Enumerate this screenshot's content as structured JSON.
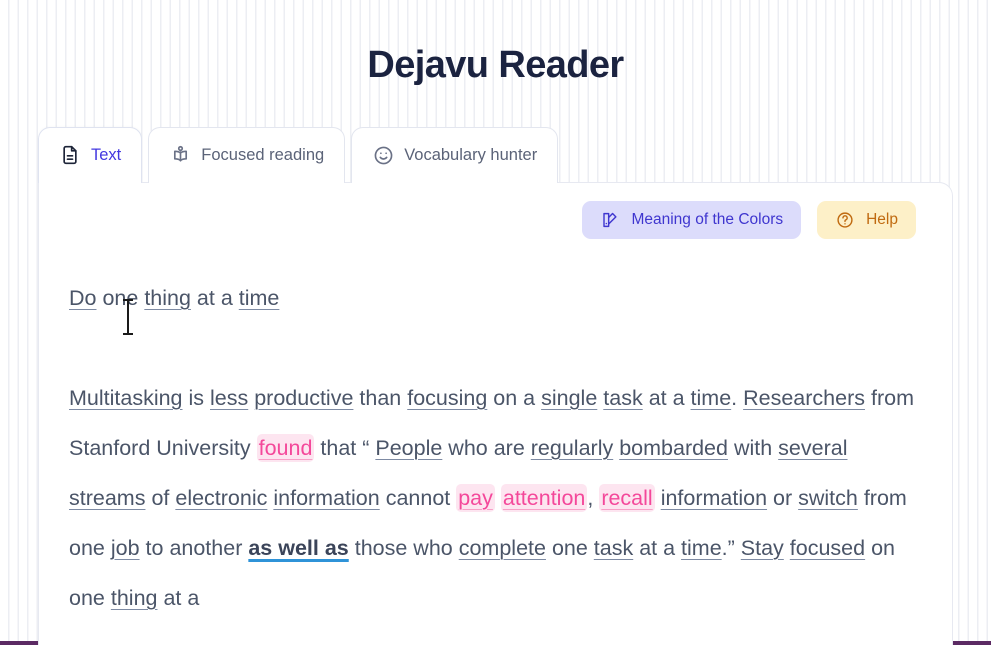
{
  "app": {
    "title": "Dejavu Reader",
    "title_color": "#1b2340",
    "bottom_bar_color": "#5b2a63"
  },
  "tabs": [
    {
      "label": "Text",
      "icon": "document-icon",
      "active": true
    },
    {
      "label": "Focused reading",
      "icon": "person-reading-book-icon",
      "active": false
    },
    {
      "label": "Vocabulary hunter",
      "icon": "smiley-face-icon",
      "active": false
    }
  ],
  "actions": {
    "colors_label": "Meaning of the Colors",
    "colors_icon": "color-palette-icon",
    "colors_bg": "#dcdcfb",
    "colors_fg": "#3f36cf",
    "help_label": "Help",
    "help_icon": "question-circle-icon",
    "help_bg": "#fdf0c8",
    "help_fg": "#c06a10"
  },
  "legend": {
    "underline_color": "#7d8aa3",
    "pink_text_color": "#f4489a",
    "pink_bg_color": "#fde5f0",
    "phrase_underline_color": "#2f93d8"
  },
  "reader": {
    "heading_tokens": [
      {
        "t": "Do",
        "s": "under"
      },
      {
        "t": " ",
        "s": "plain"
      },
      {
        "t": "one",
        "s": "plain"
      },
      {
        "t": " ",
        "s": "plain"
      },
      {
        "t": "thing",
        "s": "under"
      },
      {
        "t": " at a ",
        "s": "plain"
      },
      {
        "t": "time",
        "s": "under"
      }
    ],
    "paragraph_tokens": [
      {
        "t": "Multitasking",
        "s": "under"
      },
      {
        "t": " is ",
        "s": "plain"
      },
      {
        "t": "less",
        "s": "under"
      },
      {
        "t": " ",
        "s": "plain"
      },
      {
        "t": "productive",
        "s": "under"
      },
      {
        "t": " than ",
        "s": "plain"
      },
      {
        "t": "focusing",
        "s": "under"
      },
      {
        "t": " on a ",
        "s": "plain"
      },
      {
        "t": "single",
        "s": "under"
      },
      {
        "t": " ",
        "s": "plain"
      },
      {
        "t": "task",
        "s": "under"
      },
      {
        "t": " at a ",
        "s": "plain"
      },
      {
        "t": "time",
        "s": "under"
      },
      {
        "t": ". ",
        "s": "plain"
      },
      {
        "t": "Researchers",
        "s": "under"
      },
      {
        "t": " from Stanford University ",
        "s": "plain"
      },
      {
        "t": "found",
        "s": "pink"
      },
      {
        "t": " that “ ",
        "s": "plain"
      },
      {
        "t": "People",
        "s": "under"
      },
      {
        "t": " who are ",
        "s": "plain"
      },
      {
        "t": "regularly",
        "s": "under"
      },
      {
        "t": " ",
        "s": "plain"
      },
      {
        "t": "bombarded",
        "s": "under"
      },
      {
        "t": " with ",
        "s": "plain"
      },
      {
        "t": "several",
        "s": "under"
      },
      {
        "t": " ",
        "s": "plain"
      },
      {
        "t": "streams",
        "s": "under"
      },
      {
        "t": " of ",
        "s": "plain"
      },
      {
        "t": "electronic",
        "s": "under"
      },
      {
        "t": " ",
        "s": "plain"
      },
      {
        "t": "information",
        "s": "under"
      },
      {
        "t": " cannot ",
        "s": "plain"
      },
      {
        "t": "pay",
        "s": "pink"
      },
      {
        "t": " ",
        "s": "plain"
      },
      {
        "t": "attention",
        "s": "pink"
      },
      {
        "t": ", ",
        "s": "plain"
      },
      {
        "t": "recall",
        "s": "pink"
      },
      {
        "t": " ",
        "s": "plain"
      },
      {
        "t": "information",
        "s": "under"
      },
      {
        "t": " or ",
        "s": "plain"
      },
      {
        "t": "switch",
        "s": "under"
      },
      {
        "t": " from one ",
        "s": "plain"
      },
      {
        "t": "job",
        "s": "under"
      },
      {
        "t": " to another ",
        "s": "plain"
      },
      {
        "t": "as well as",
        "s": "phrase"
      },
      {
        "t": " those who ",
        "s": "plain"
      },
      {
        "t": "complete",
        "s": "under"
      },
      {
        "t": " one ",
        "s": "plain"
      },
      {
        "t": "task",
        "s": "under"
      },
      {
        "t": " at a ",
        "s": "plain"
      },
      {
        "t": "time",
        "s": "under"
      },
      {
        "t": ".” ",
        "s": "plain"
      },
      {
        "t": "Stay",
        "s": "under"
      },
      {
        "t": " ",
        "s": "plain"
      },
      {
        "t": "focused",
        "s": "under"
      },
      {
        "t": " on one ",
        "s": "plain"
      },
      {
        "t": "thing",
        "s": "under"
      },
      {
        "t": " at a",
        "s": "plain"
      }
    ]
  },
  "cursor": {
    "type": "text-ibeam-cursor"
  }
}
